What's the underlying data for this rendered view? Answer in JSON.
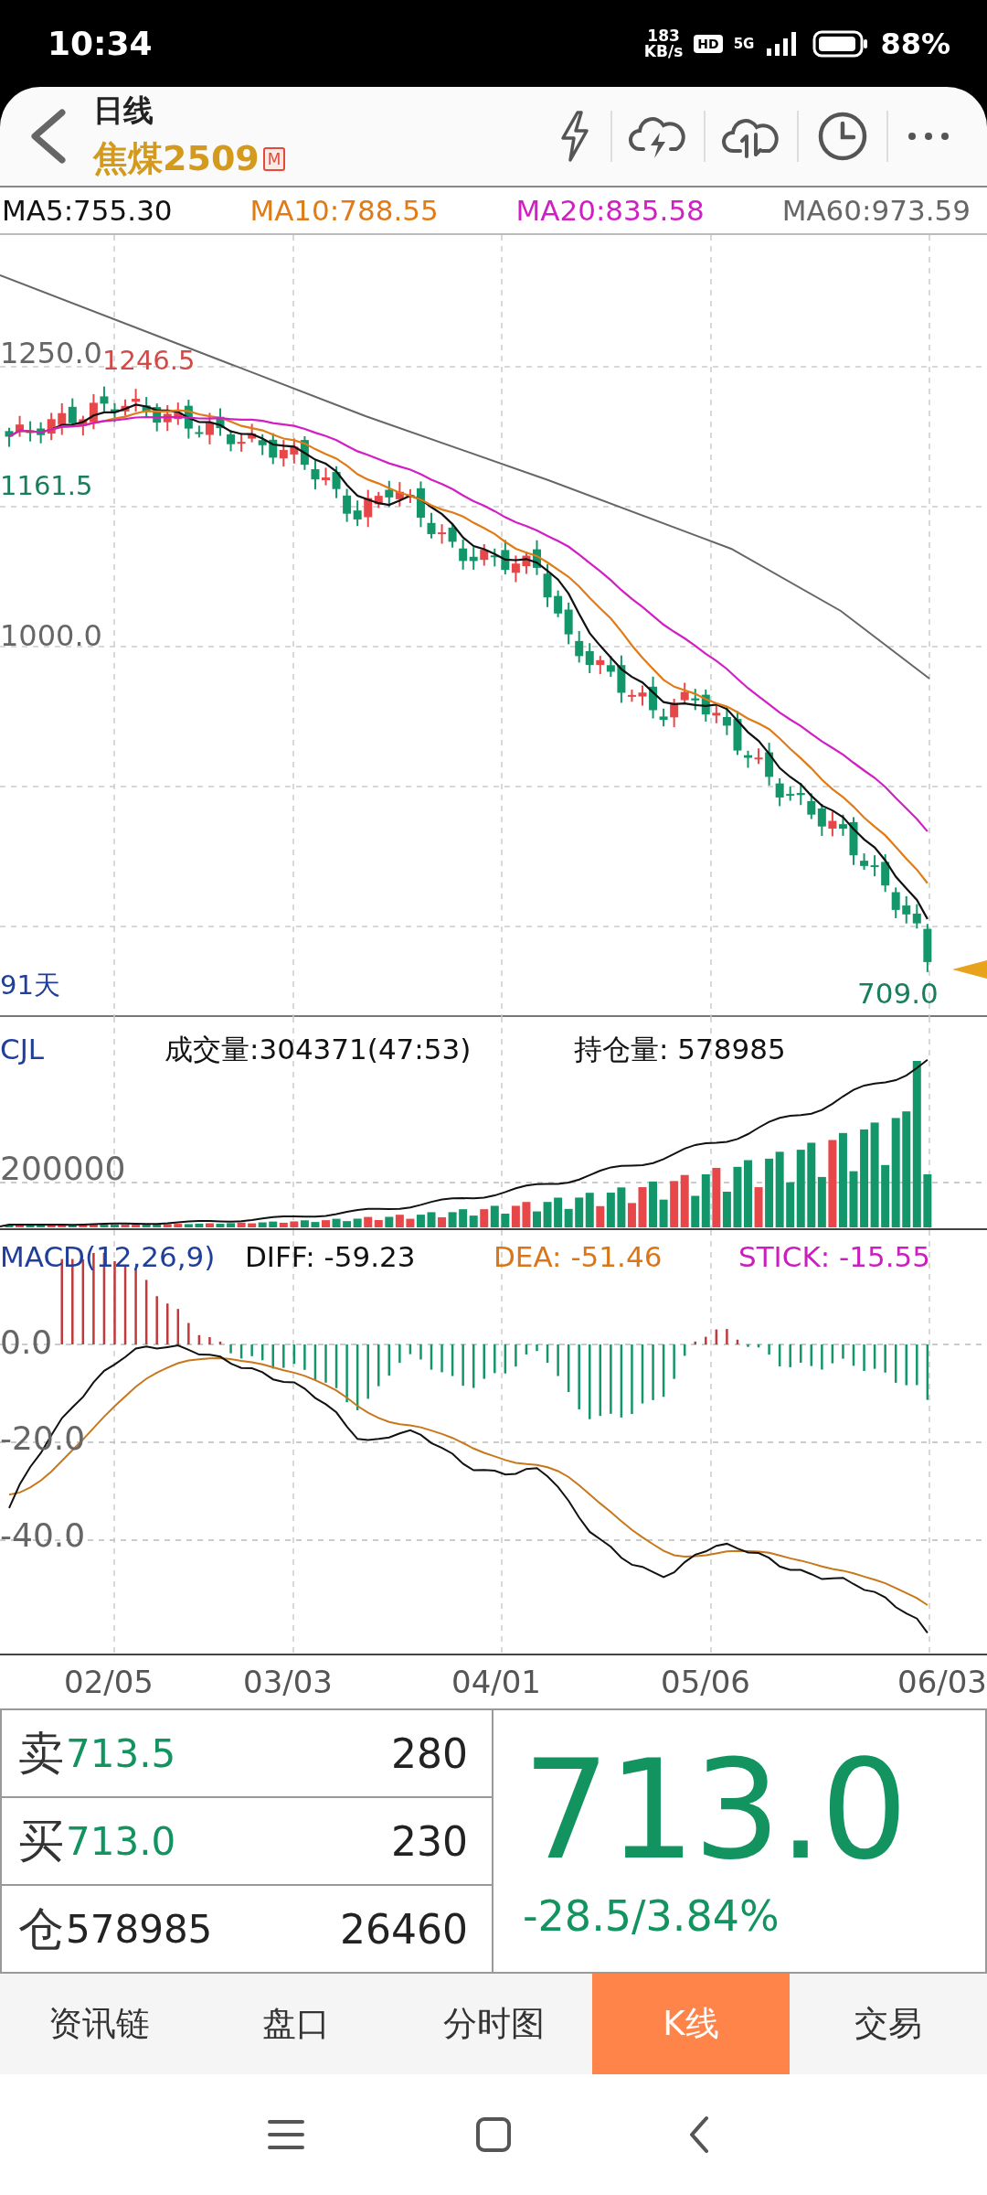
{
  "status_bar": {
    "time": "10:34",
    "net_speed": "183",
    "net_unit": "KB/s",
    "hd": "HD",
    "network": "5G",
    "battery": "88%"
  },
  "header": {
    "title": "日线",
    "symbol": "焦煤2509",
    "badge": "M"
  },
  "ma_legend": [
    {
      "label": "MA5:755.30",
      "color": "#111111"
    },
    {
      "label": "MA10:788.55",
      "color": "#e07b16"
    },
    {
      "label": "MA20:835.58",
      "color": "#d21fc4"
    },
    {
      "label": "MA60:973.59",
      "color": "#666666"
    }
  ],
  "price_chart": {
    "axis_labels": [
      {
        "text": "1250.0",
        "kind": "axis"
      },
      {
        "text": "1246.5",
        "kind": "high"
      },
      {
        "text": "1161.5",
        "kind": "low"
      },
      {
        "text": "1000.0",
        "kind": "axis"
      }
    ],
    "period": "91天",
    "last_low": "709.0"
  },
  "volume": {
    "title": "CJL",
    "volume": "成交量:304371(47:53)",
    "open_interest": "持仓量: 578985",
    "y_label": "200000"
  },
  "macd": {
    "title": "MACD(12,26,9)",
    "diff": "DIFF: -59.23",
    "dea": "DEA: -51.46",
    "stick": "STICK: -15.55",
    "y_labels": [
      "0.0",
      "-20.0",
      "-40.0"
    ]
  },
  "dates": [
    "02/05",
    "03/03",
    "04/01",
    "05/06",
    "06/03"
  ],
  "quote": {
    "rows": [
      {
        "label": "卖",
        "price": "713.5",
        "qty": "280",
        "kind": "ask"
      },
      {
        "label": "买",
        "price": "713.0",
        "qty": "230",
        "kind": "bid"
      },
      {
        "label": "仓",
        "price": "578985",
        "qty": "26460",
        "kind": "open_interest"
      }
    ],
    "last_price": "713.0",
    "change": "-28.5/3.84%"
  },
  "tabs": [
    {
      "label": "资讯链",
      "selected": false
    },
    {
      "label": "盘口",
      "selected": false
    },
    {
      "label": "分时图",
      "selected": false
    },
    {
      "label": "K线",
      "selected": true
    },
    {
      "label": "交易",
      "selected": false
    }
  ]
}
